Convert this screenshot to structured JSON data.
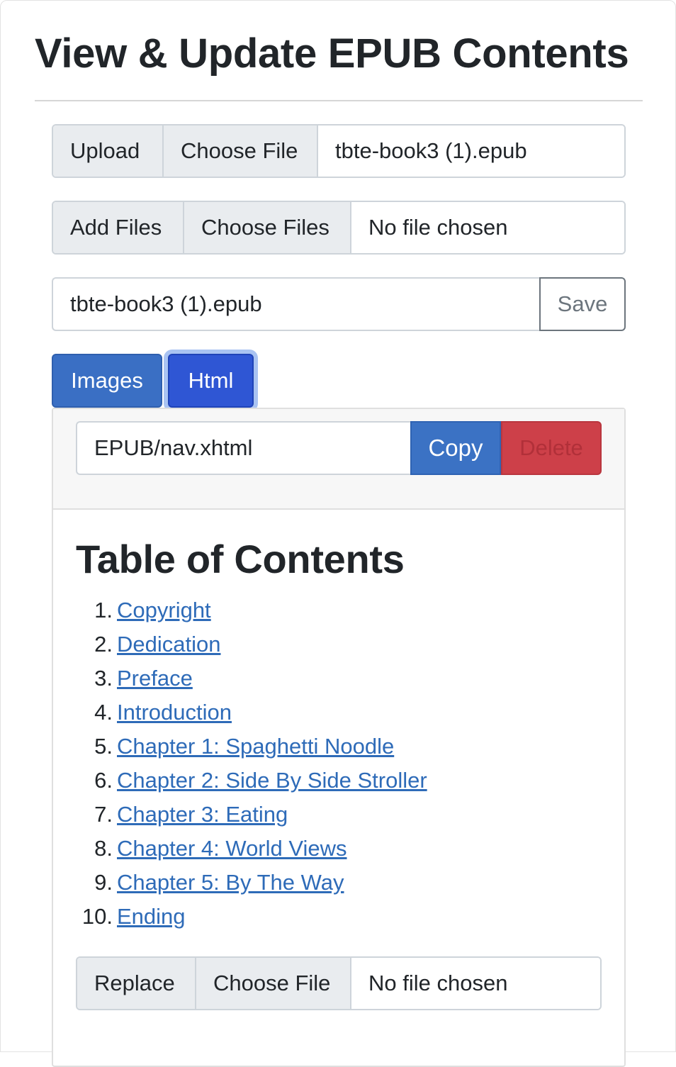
{
  "page": {
    "title": "View & Update EPUB Contents"
  },
  "upload_group": {
    "button_label": "Upload",
    "choose_label": "Choose File",
    "file_name": "tbte-book3 (1).epub"
  },
  "add_files_group": {
    "button_label": "Add Files",
    "choose_label": "Choose Files",
    "file_name": "No file chosen"
  },
  "save_row": {
    "name_value": "tbte-book3 (1).epub",
    "save_label": "Save"
  },
  "tabs": [
    {
      "label": "Images",
      "active": false
    },
    {
      "label": "Html",
      "active": true
    }
  ],
  "file_toolbar": {
    "path_value": "EPUB/nav.xhtml",
    "copy_label": "Copy",
    "delete_label": "Delete"
  },
  "preview": {
    "heading": "Table of Contents",
    "items": [
      {
        "num": "1.",
        "label": "Copyright"
      },
      {
        "num": "2.",
        "label": "Dedication"
      },
      {
        "num": "3.",
        "label": "Preface"
      },
      {
        "num": "4.",
        "label": "Introduction"
      },
      {
        "num": "5.",
        "label": "Chapter 1: Spaghetti Noodle"
      },
      {
        "num": "6.",
        "label": "Chapter 2: Side By Side Stroller"
      },
      {
        "num": "7.",
        "label": "Chapter 3: Eating"
      },
      {
        "num": "8.",
        "label": "Chapter 4: World Views"
      },
      {
        "num": "9.",
        "label": "Chapter 5: By The Way"
      },
      {
        "num": "10.",
        "label": "Ending"
      }
    ]
  },
  "replace_group": {
    "button_label": "Replace",
    "choose_label": "Choose File",
    "file_name": "No file chosen"
  },
  "colors": {
    "primary": "#3b72c4",
    "active_tab": "#2f56d4",
    "danger": "#cd4049",
    "link": "#2e6bb8"
  }
}
